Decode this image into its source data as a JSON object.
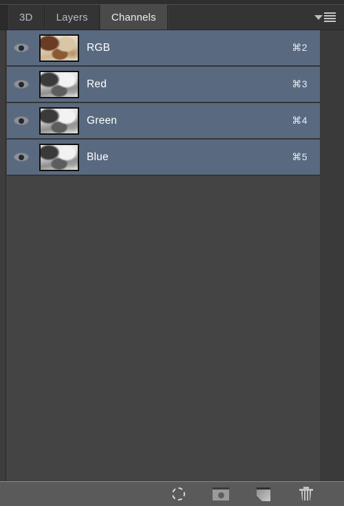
{
  "panel": {
    "title": "Channels",
    "tabs": [
      {
        "label": "3D",
        "active": false
      },
      {
        "label": "Layers",
        "active": false
      },
      {
        "label": "Channels",
        "active": true
      }
    ],
    "menu_icon": "panel-menu-icon"
  },
  "channels": [
    {
      "name": "RGB",
      "shortcut": "⌘2",
      "visible": true,
      "selected": true,
      "thumbnail": "composite-color-thumbnail"
    },
    {
      "name": "Red",
      "shortcut": "⌘3",
      "visible": true,
      "selected": true,
      "thumbnail": "red-channel-grayscale-thumbnail"
    },
    {
      "name": "Green",
      "shortcut": "⌘4",
      "visible": true,
      "selected": true,
      "thumbnail": "green-channel-grayscale-thumbnail"
    },
    {
      "name": "Blue",
      "shortcut": "⌘5",
      "visible": true,
      "selected": true,
      "thumbnail": "blue-channel-grayscale-thumbnail"
    }
  ],
  "bottom_toolbar": {
    "buttons": [
      {
        "name": "load-channel-as-selection",
        "icon": "dashed-selection-icon"
      },
      {
        "name": "save-selection-as-channel",
        "icon": "quick-mask-icon"
      },
      {
        "name": "create-new-channel",
        "icon": "new-page-icon"
      },
      {
        "name": "delete-channel",
        "icon": "trash-icon"
      }
    ]
  },
  "colors": {
    "panel_bg": "#444444",
    "row_selected": "#596a80",
    "tab_bar_bg": "#323232",
    "tab_active_bg": "#4a4a4a",
    "bottom_bar_bg": "#5a5a5a",
    "text_primary": "#ffffff",
    "text_tab_inactive": "#b6bcc6"
  }
}
